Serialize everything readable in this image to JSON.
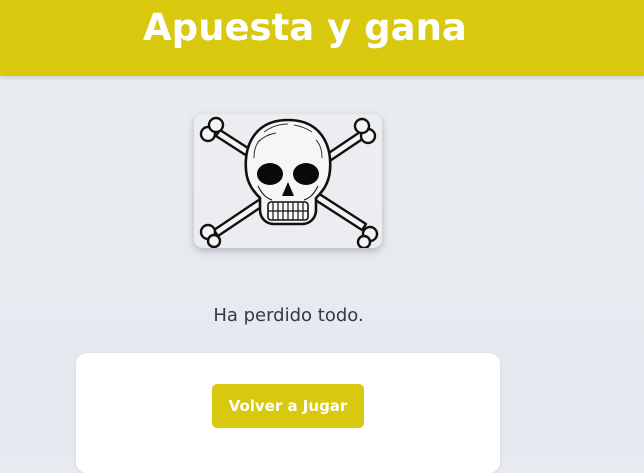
{
  "header": {
    "title": "Apuesta y gana",
    "bg_color": "#d8c90e"
  },
  "result": {
    "image_icon": "skull-and-crossbones-icon",
    "message": "Ha perdido todo."
  },
  "actions": {
    "play_again_label": "Volver a Jugar"
  }
}
